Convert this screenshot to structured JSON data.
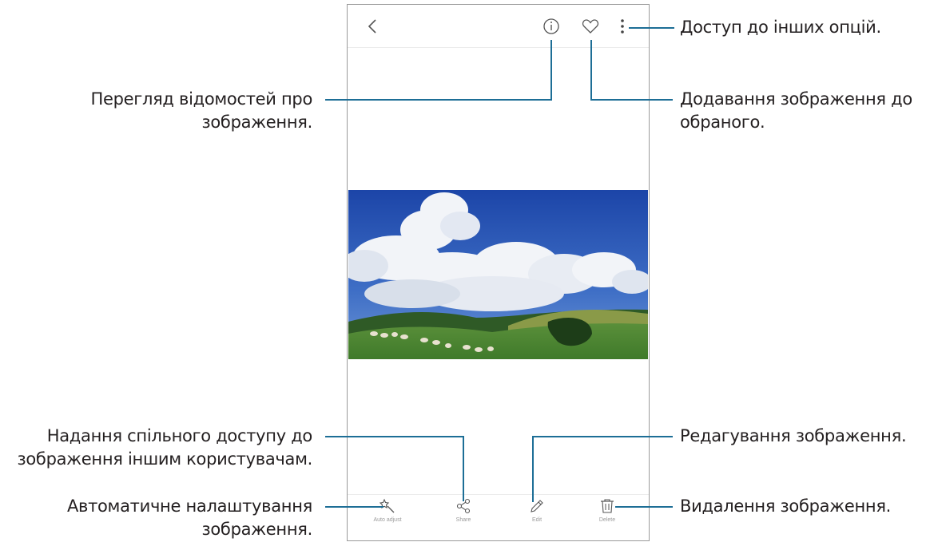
{
  "callouts": {
    "more_options": "Доступ до інших опцій.",
    "view_details": [
      "Перегляд відомостей про",
      "зображення."
    ],
    "add_favourite": [
      "Додавання зображення до",
      "обраного."
    ],
    "share": [
      "Надання спільного доступу до",
      "зображення іншим користувачам."
    ],
    "edit": "Редагування зображення.",
    "auto_adjust": [
      "Автоматичне налаштування",
      "зображення."
    ],
    "delete": "Видалення зображення."
  },
  "toolbar": {
    "auto_adjust_label": "Auto adjust",
    "share_label": "Share",
    "edit_label": "Edit",
    "delete_label": "Delete"
  },
  "icons": {
    "back": "chevron-left-icon",
    "details": "info-icon",
    "favourite": "heart-icon",
    "more": "more-vertical-icon",
    "auto_adjust": "magic-wand-icon",
    "share": "share-icon",
    "edit": "pencil-icon",
    "delete": "trash-icon"
  },
  "colors": {
    "leader_line": "#1d6e96",
    "phone_border": "#9a9a9a",
    "icon": "#555555"
  }
}
